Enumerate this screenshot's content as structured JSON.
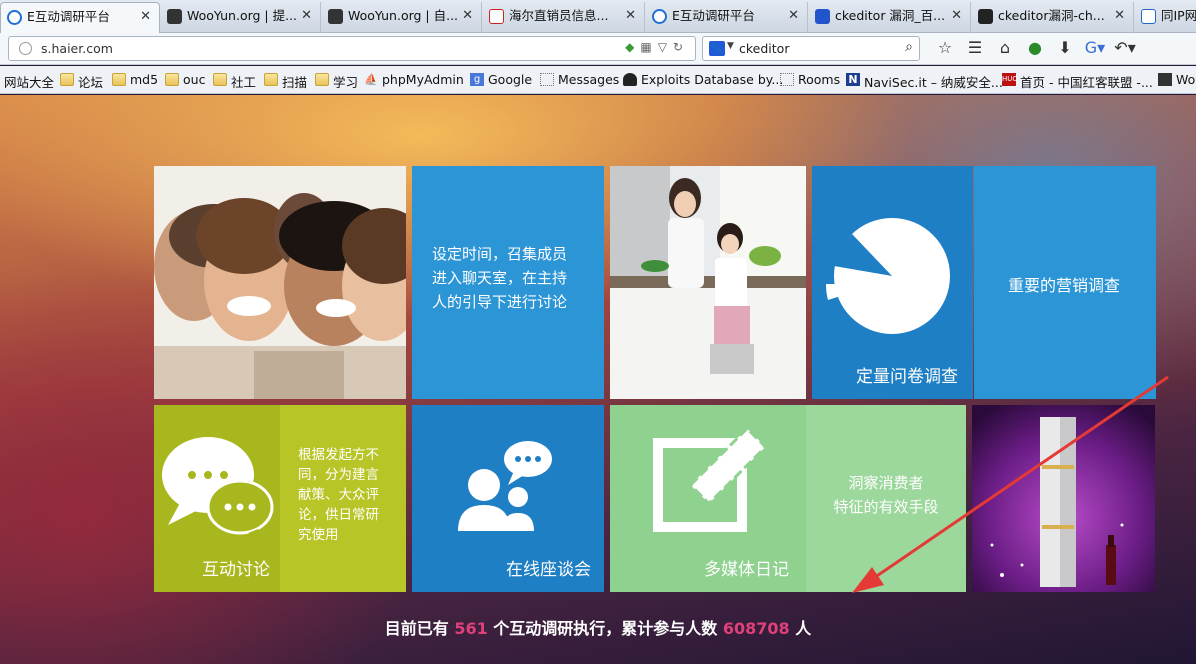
{
  "tabs": [
    {
      "title": "E互动调研平台",
      "icon_color": "#1e6fd6",
      "close": "✕"
    },
    {
      "title": "WooYun.org | 提...",
      "icon_color": "#333333",
      "close": "✕"
    },
    {
      "title": "WooYun.org | 自...",
      "icon_color": "#333333",
      "close": "✕"
    },
    {
      "title": "海尔直销员信息...",
      "icon_color": "#cc2222",
      "close": "✕"
    },
    {
      "title": "E互动调研平台",
      "icon_color": "#1e6fd6",
      "close": "✕"
    },
    {
      "title": "ckeditor 漏洞_百...",
      "icon_color": "#2255cc",
      "close": "✕"
    },
    {
      "title": "ckeditor漏洞-ch...",
      "icon_color": "#222222",
      "close": "✕"
    },
    {
      "title": "同IP网",
      "icon_color": "#2266cc",
      "close": ""
    }
  ],
  "nav": {
    "url": "s.haier.com",
    "search_value": "ckeditor",
    "search_engine_glyph": "🐾"
  },
  "bookmarks": [
    {
      "label": "网站大全",
      "icon": "none"
    },
    {
      "label": "论坛",
      "icon": "folder-icon"
    },
    {
      "label": "md5",
      "icon": "folder-icon"
    },
    {
      "label": "ouc",
      "icon": "folder-icon"
    },
    {
      "label": "社工",
      "icon": "folder-icon"
    },
    {
      "label": "扫描",
      "icon": "folder-icon"
    },
    {
      "label": "学习",
      "icon": "folder-icon"
    },
    {
      "label": "phpMyAdmin",
      "icon": "pma-icon"
    },
    {
      "label": "Google",
      "icon": "google-icon"
    },
    {
      "label": "Messages",
      "icon": "page-icon"
    },
    {
      "label": "Exploits Database by...",
      "icon": "exploit-icon"
    },
    {
      "label": "Rooms",
      "icon": "page-icon"
    },
    {
      "label": "NaviSec.it – 纳威安全...",
      "icon": "navisec-icon"
    },
    {
      "label": "首页 - 中国红客联盟 -...",
      "icon": "huc-icon"
    },
    {
      "label": "Wo",
      "icon": "wooyun-icon"
    }
  ],
  "tiles": {
    "discussion_topic_text": [
      "设定时间，召集成员",
      "进入聊天室，在主持",
      "人的引导下进行讨论"
    ],
    "survey_title": "定量问卷调查",
    "survey_desc": "重要的营销调查",
    "interactive_title": "互动讨论",
    "interactive_desc": [
      "根据发起方不",
      "同，分为建言",
      "献策、大众评",
      "论，供日常研",
      "究使用"
    ],
    "seminar_title": "在线座谈会",
    "diary_title": "多媒体日记",
    "diary_desc": [
      "洞察消费者",
      "特征的有效手段"
    ]
  },
  "footer": {
    "prefix": "目前已有 ",
    "projects": "561",
    "middle": " 个互动调研执行，累计参与人数 ",
    "participants": "608708",
    "suffix": " 人"
  },
  "colors": {
    "tile_blue": "#2b95d6",
    "tile_dark_blue": "#1f7fc4",
    "tile_olive": "#aebc24",
    "tile_green": "#8fd18f",
    "accent_number": "#e0407a",
    "annotation_arrow": "#e53935"
  }
}
